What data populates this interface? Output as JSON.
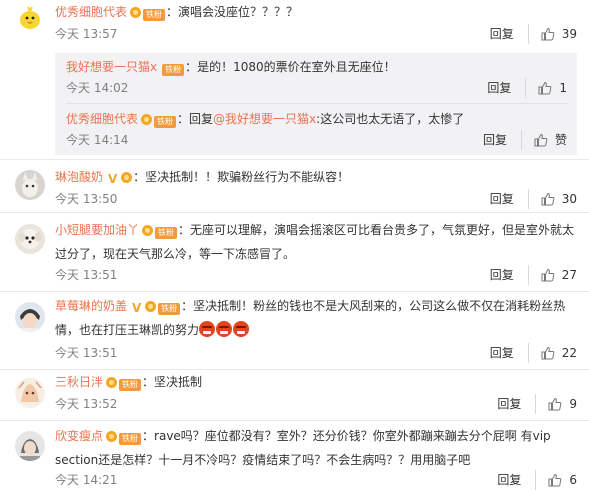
{
  "colors": {
    "username": "#eb7350",
    "time": "#808080",
    "sub_bg": "#f2f2f5",
    "fan_badge": "#f29a3c"
  },
  "icons": {
    "like": "thumbs-up-icon",
    "vip": "crown-icon",
    "fan": "fan-badge"
  },
  "comments": [
    {
      "user": "优秀细胞代表",
      "fan_label": "铁粉",
      "text": "演唱会没座位？？？？",
      "time": "今天 13:57",
      "reply_label": "回复",
      "likes": "39",
      "replies": [
        {
          "user": "我好想要一只猫x",
          "fan_label": "铁粉",
          "text": "是的！1080的票价在室外且无座位！",
          "time": "今天 14:02",
          "reply_label": "回复",
          "likes": "1"
        },
        {
          "user": "优秀细胞代表",
          "fan_label": "铁粉",
          "prefix": "回复",
          "mention": "@我好想要一只猫x",
          "text": "这公司也太无语了，太惨了",
          "time": "今天 14:14",
          "reply_label": "回复",
          "likes": "赞"
        }
      ]
    },
    {
      "user": "琳泡酸奶",
      "verified": "V",
      "text": "坚决抵制！！欺骗粉丝行为不能纵容！",
      "time": "今天 13:50",
      "reply_label": "回复",
      "likes": "30"
    },
    {
      "user": "小短腿要加油丫",
      "fan_label": "铁粉",
      "text": "无座可以理解，演唱会摇滚区可比看台贵多了，气氛更好，但是室外就太过分了，现在天气那么冷，等一下冻感冒了。",
      "time": "今天 13:51",
      "reply_label": "回复",
      "likes": "27"
    },
    {
      "user": "草莓琳的奶盖",
      "verified": "V",
      "fan_label": "铁粉",
      "text": "坚决抵制！粉丝的钱也不是大风刮来的，公司这么做不仅在消耗粉丝热情，也在打压王琳凯的努力",
      "time": "今天 13:51",
      "reply_label": "回复",
      "likes": "22"
    },
    {
      "user": "三秋日泮",
      "fan_label": "铁粉",
      "text": "坚决抵制",
      "time": "今天 13:52",
      "reply_label": "回复",
      "likes": "9"
    },
    {
      "user": "欣变瘦点",
      "fan_label": "铁粉",
      "text": "rave吗？座位都没有？室外？还分价钱？你室外都蹦来蹦去分个屁啊 有vip section还是怎样？十一月不冷吗？疫情结束了吗？不会生病吗？？用用脑子吧",
      "time": "今天 14:21",
      "reply_label": "回复",
      "likes": "6"
    }
  ]
}
